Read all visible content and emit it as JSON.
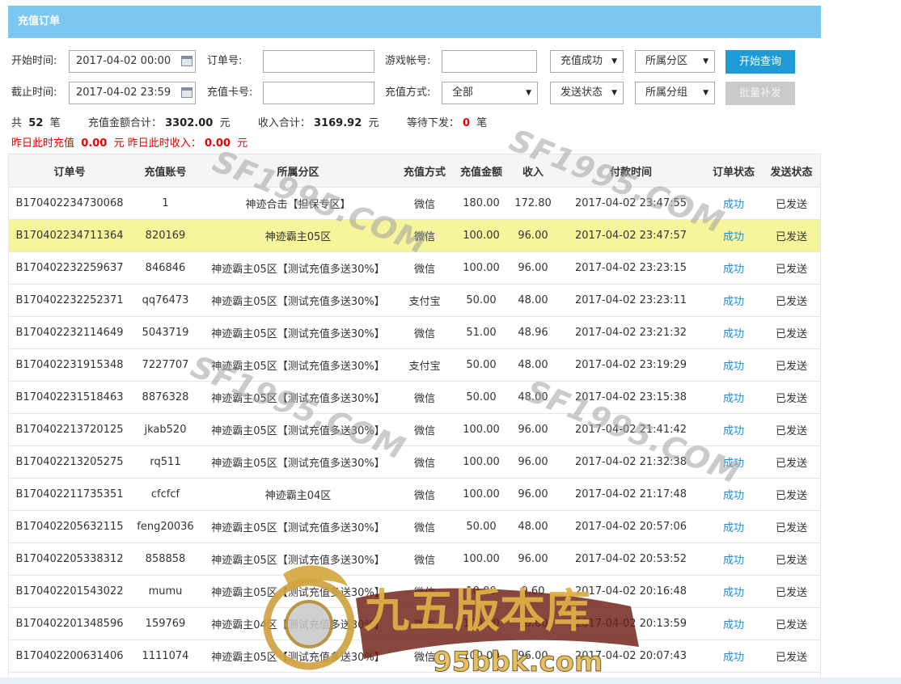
{
  "header": {
    "title": "充值订单"
  },
  "filters": {
    "start_label": "开始时间:",
    "start_value": "2017-04-02 00:00",
    "end_label": "截止时间:",
    "end_value": "2017-04-02 23:59",
    "order_label": "订单号:",
    "card_label": "充值卡号:",
    "account_label": "游戏帐号:",
    "method_label": "充值方式:",
    "method_value": "全部",
    "recharge_status": "充值成功",
    "send_status": "发送状态",
    "zone": "所属分区",
    "group": "所属分组",
    "query_button": "开始查询",
    "resend_button": "批量补发"
  },
  "summary": {
    "total_prefix": "共",
    "total_count": "52",
    "total_unit": "笔",
    "amount_label": "充值金额合计：",
    "amount_value": "3302.00",
    "amount_unit": "元",
    "income_label": "收入合计：",
    "income_value": "3169.92",
    "income_unit": "元",
    "pending_label": "等待下发：",
    "pending_value": "0",
    "pending_unit": "笔",
    "yday_recharge_label": "昨日此时充值",
    "yday_recharge_value": "0.00",
    "yday_recharge_unit": "元",
    "yday_income_label": "昨日此时收入：",
    "yday_income_value": "0.00",
    "yday_income_unit": "元"
  },
  "table": {
    "columns": [
      "订单号",
      "充值账号",
      "所属分区",
      "充值方式",
      "充值金额",
      "收入",
      "付款时间",
      "订单状态",
      "发送状态"
    ],
    "rows": [
      [
        "B170402234730068",
        "1",
        "神迹合击【担保专区】",
        "微信",
        "180.00",
        "172.80",
        "2017-04-02 23:47:55",
        "成功",
        "已发送"
      ],
      [
        "B170402234711364",
        "820169",
        "神迹霸主05区",
        "微信",
        "100.00",
        "96.00",
        "2017-04-02 23:47:57",
        "成功",
        "已发送"
      ],
      [
        "B170402232259637",
        "846846",
        "神迹霸主05区【测试充值多送30%】",
        "微信",
        "100.00",
        "96.00",
        "2017-04-02 23:23:15",
        "成功",
        "已发送"
      ],
      [
        "B170402232252371",
        "qq76473",
        "神迹霸主05区【测试充值多送30%】",
        "支付宝",
        "50.00",
        "48.00",
        "2017-04-02 23:23:11",
        "成功",
        "已发送"
      ],
      [
        "B170402232114649",
        "5043719",
        "神迹霸主05区【测试充值多送30%】",
        "微信",
        "51.00",
        "48.96",
        "2017-04-02 23:21:32",
        "成功",
        "已发送"
      ],
      [
        "B170402231915348",
        "7227707",
        "神迹霸主05区【测试充值多送30%】",
        "支付宝",
        "50.00",
        "48.00",
        "2017-04-02 23:19:29",
        "成功",
        "已发送"
      ],
      [
        "B170402231518463",
        "8876328",
        "神迹霸主05区【测试充值多送30%】",
        "微信",
        "50.00",
        "48.00",
        "2017-04-02 23:15:38",
        "成功",
        "已发送"
      ],
      [
        "B170402213720125",
        "jkab520",
        "神迹霸主05区【测试充值多送30%】",
        "微信",
        "100.00",
        "96.00",
        "2017-04-02 21:41:42",
        "成功",
        "已发送"
      ],
      [
        "B170402213205275",
        "rq511",
        "神迹霸主05区【测试充值多送30%】",
        "微信",
        "100.00",
        "96.00",
        "2017-04-02 21:32:38",
        "成功",
        "已发送"
      ],
      [
        "B170402211735351",
        "cfcfcf",
        "神迹霸主04区",
        "微信",
        "100.00",
        "96.00",
        "2017-04-02 21:17:48",
        "成功",
        "已发送"
      ],
      [
        "B170402205632115",
        "feng20036",
        "神迹霸主05区【测试充值多送30%】",
        "微信",
        "50.00",
        "48.00",
        "2017-04-02 20:57:06",
        "成功",
        "已发送"
      ],
      [
        "B170402205338312",
        "858858",
        "神迹霸主05区【测试充值多送30%】",
        "微信",
        "100.00",
        "96.00",
        "2017-04-02 20:53:52",
        "成功",
        "已发送"
      ],
      [
        "B170402201543022",
        "mumu",
        "神迹霸主05区【测试充值多送30%】",
        "微信",
        "10.00",
        "9.60",
        "2017-04-02 20:16:48",
        "成功",
        "已发送"
      ],
      [
        "B170402201348596",
        "159769",
        "神迹霸主04区【测试充值多送30%】",
        "微信",
        "100.00",
        "96.00",
        "2017-04-02 20:13:59",
        "成功",
        "已发送"
      ],
      [
        "B170402200631406",
        "1111074",
        "神迹霸主05区【测试充值多送30%】",
        "微信",
        "100.00",
        "96.00",
        "2017-04-02 20:07:43",
        "成功",
        "已发送"
      ]
    ],
    "highlight_row": 1
  },
  "watermarks": {
    "text": "SF1995.COM",
    "logo_title": "九五版本库",
    "logo_url": "95bbk.com"
  },
  "colors": {
    "header_bg": "#7cc7f2",
    "primary_button": "#1e9ad6",
    "highlight_row": "#f6f59c",
    "status_link": "#1e8fd6",
    "alert_red": "#e00000"
  }
}
